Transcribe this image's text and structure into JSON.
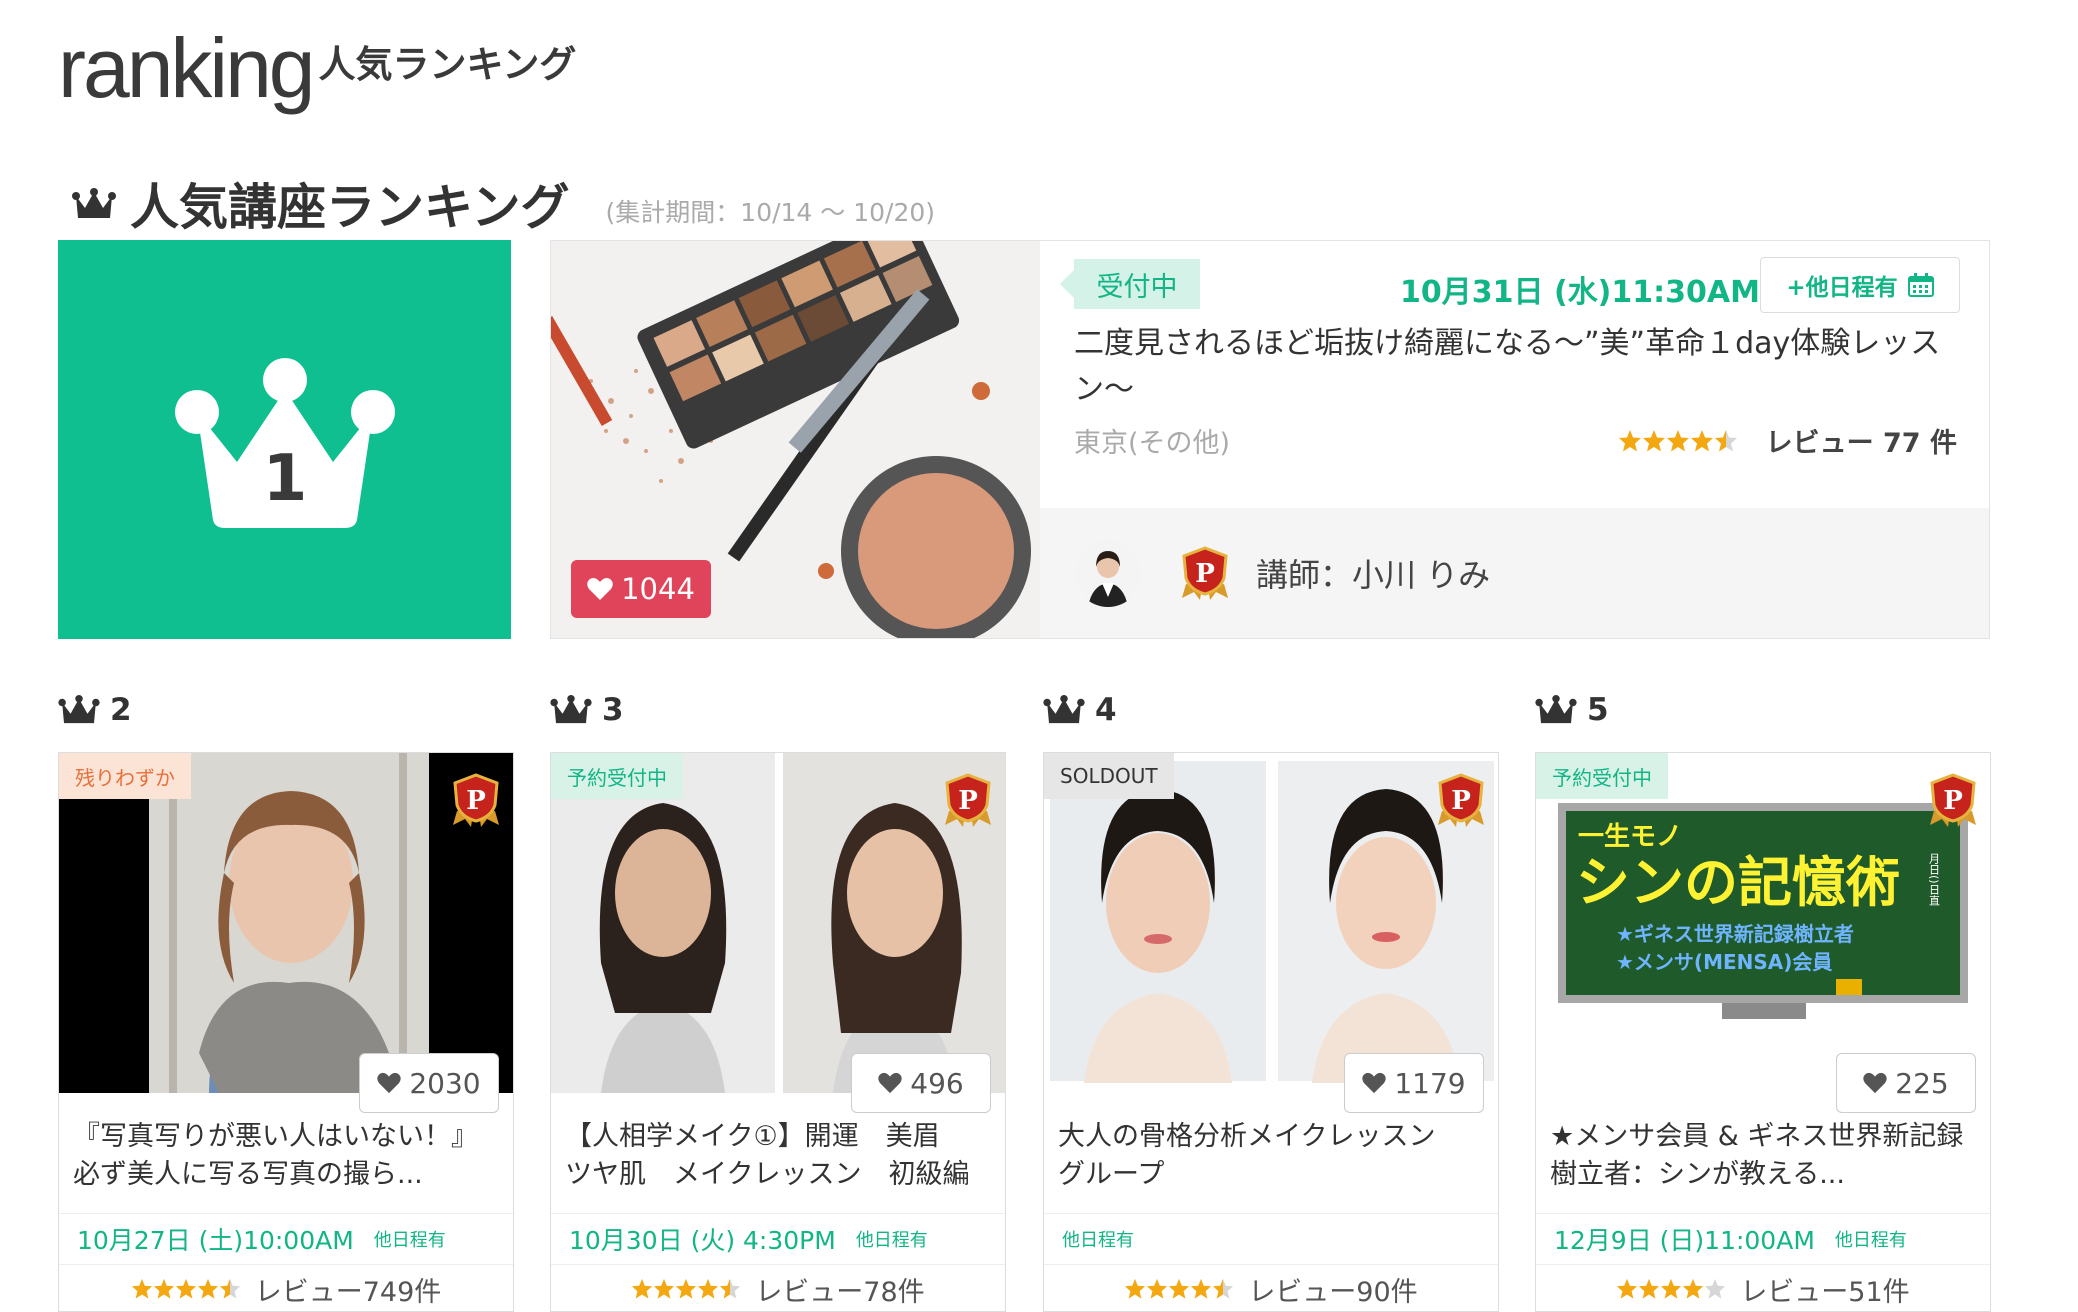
{
  "header": {
    "logo": "ranking",
    "subtitle": "人気ランキング"
  },
  "section": {
    "title": "人気講座ランキング",
    "period": "(集計期間：10/14 〜 10/20)"
  },
  "first": {
    "rank": "1",
    "likes": "1044",
    "status": "受付中",
    "date": "10月31日 (水)11:30AM",
    "other_dates": "+他日程有",
    "title": "二度見されるほど垢抜け綺麗になる〜”美”革命１day体験レッスン〜",
    "location": "東京(その他)",
    "rating": 4.5,
    "reviews": "レビュー 77 件",
    "instructor": "講師：小川 りみ"
  },
  "cards": [
    {
      "rank": "2",
      "status": "残りわずか",
      "likes": "2030",
      "title": "『写真写りが悪い人はいない！』必ず美人に写る写真の撮ら...",
      "date": "10月27日 (土)10:00AM",
      "other": "他日程有",
      "rating": 4.5,
      "reviews": "レビュー749件"
    },
    {
      "rank": "3",
      "status": "予約受付中",
      "likes": "496",
      "title": "【人相学メイク①】開運　美眉　ツヤ肌　メイクレッスン　初級編",
      "date": "10月30日 (火) 4:30PM",
      "other": "他日程有",
      "rating": 4.5,
      "reviews": "レビュー78件"
    },
    {
      "rank": "4",
      "status": "SOLDOUT",
      "likes": "1179",
      "title": "大人の骨格分析メイクレッスン　グループ",
      "date": "",
      "other": "他日程有",
      "rating": 4.5,
      "reviews": "レビュー90件"
    },
    {
      "rank": "5",
      "status": "予約受付中",
      "likes": "225",
      "title": "★メンサ会員 & ギネス世界新記録樹立者：シンが教える...",
      "date": "12月9日 (日)11:00AM",
      "other": "他日程有",
      "rating": 4.0,
      "reviews": "レビュー51件"
    }
  ],
  "card5_image": {
    "top": "一生モノ",
    "main": "シンの記憶術",
    "line1": "★ギネス世界新記録樹立者",
    "line2": "★メンサ(MENSA)会員",
    "side": "月日()日直"
  },
  "colors": {
    "accent": "#12b585",
    "rank1_bg": "#0fbf8f",
    "like_red": "#e0445a",
    "star": "#f3a812"
  },
  "icons": {
    "crown": "crown-icon",
    "heart": "heart-icon",
    "calendar": "calendar-icon",
    "medal": "premium-medal-icon"
  }
}
